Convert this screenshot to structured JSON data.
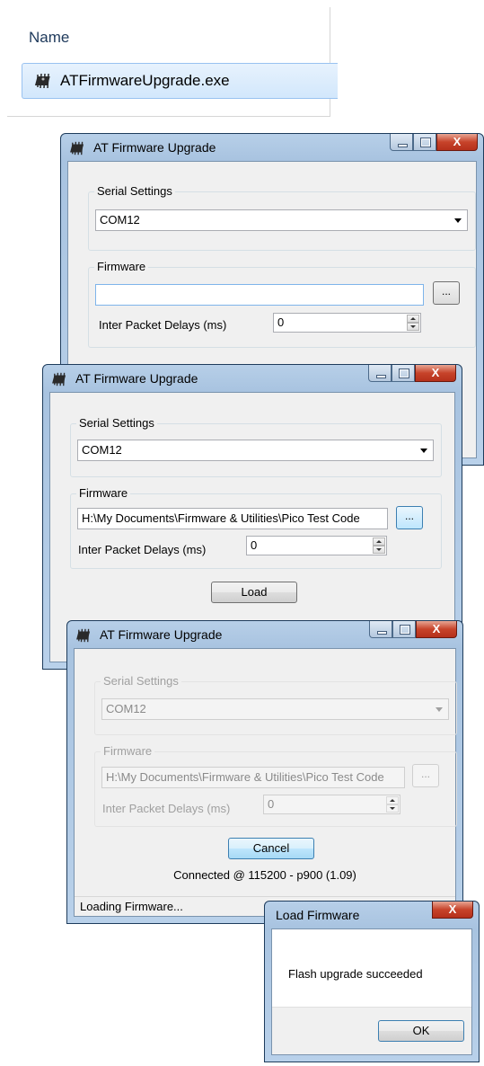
{
  "explorer": {
    "column_header": "Name",
    "file_name": "ATFirmwareUpgrade.exe",
    "file_icon": "chip-icon"
  },
  "window1": {
    "title": "AT Firmware Upgrade",
    "serial_group": "Serial Settings",
    "port_value": "COM12",
    "firmware_group": "Firmware",
    "firmware_path": "",
    "browse_label": "...",
    "delay_label": "Inter Packet Delays (ms)",
    "delay_value": "0",
    "close_glyph": "X"
  },
  "window2": {
    "title": "AT Firmware Upgrade",
    "serial_group": "Serial Settings",
    "port_value": "COM12",
    "firmware_group": "Firmware",
    "firmware_path": "H:\\My Documents\\Firmware & Utilities\\Pico Test Code",
    "browse_label": "...",
    "delay_label": "Inter Packet Delays (ms)",
    "delay_value": "0",
    "load_label": "Load",
    "close_glyph": "X"
  },
  "window3": {
    "title": "AT Firmware Upgrade",
    "serial_group": "Serial Settings",
    "port_value": "COM12",
    "firmware_group": "Firmware",
    "firmware_path": "H:\\My Documents\\Firmware & Utilities\\Pico Test Code",
    "browse_label": "...",
    "delay_label": "Inter Packet Delays (ms)",
    "delay_value": "0",
    "cancel_label": "Cancel",
    "connection_status": "Connected @ 115200 - p900 (1.09)",
    "status_text": "Loading Firmware...",
    "close_glyph": "X"
  },
  "message_box": {
    "title": "Load Firmware",
    "message": "Flash upgrade succeeded",
    "ok_label": "OK",
    "close_glyph": "X"
  }
}
